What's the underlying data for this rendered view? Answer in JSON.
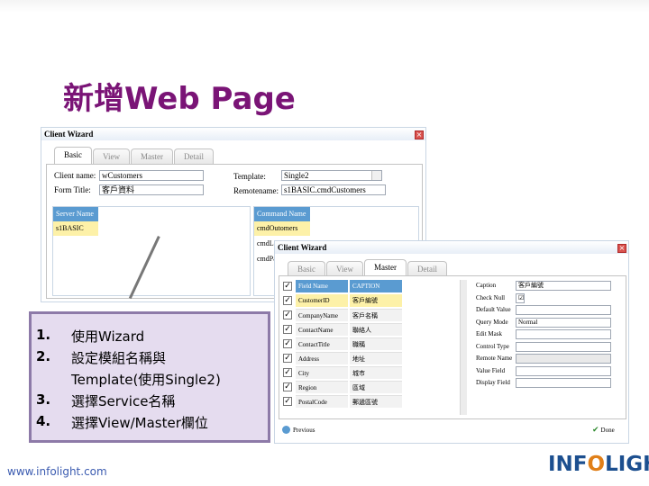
{
  "slide": {
    "title": "新增Web Page",
    "footer": "www.infolight.com",
    "logo": {
      "left": "INF",
      "middle": "O",
      "right": "LIGHT"
    }
  },
  "wizard1": {
    "title": "Client Wizard",
    "close_glyph": "×",
    "tabs": [
      "Basic",
      "View",
      "Master",
      "Detail"
    ],
    "fields": {
      "client_name_label": "Client name:",
      "client_name_value": "wCustomers",
      "form_title_label": "Form Title:",
      "form_title_value": "客戶資料",
      "template_label": "Template:",
      "template_value": "Single2",
      "remotename_label": "Remotename:",
      "remotename_value": "s1BASIC.cmdCustomers"
    },
    "server_grid": {
      "header": "Server Name",
      "rows": [
        "s1BASIC"
      ]
    },
    "command_grid": {
      "header": "Command Name",
      "rows": [
        "cmdOutomers",
        "cmdLo",
        "cmdPa"
      ]
    }
  },
  "wizard2": {
    "title": "Client Wizard",
    "close_glyph": "×",
    "tabs": [
      "Basic",
      "View",
      "Master",
      "Detail"
    ],
    "columns": [
      "Field Name",
      "CAPTION"
    ],
    "rows": [
      {
        "field": "CustomerID",
        "caption": "客戶編號",
        "checked": true
      },
      {
        "field": "CompanyName",
        "caption": "客戶名稱",
        "checked": true
      },
      {
        "field": "ContactName",
        "caption": "聯絡人",
        "checked": true
      },
      {
        "field": "ContactTitle",
        "caption": "職稱",
        "checked": true
      },
      {
        "field": "Address",
        "caption": "地址",
        "checked": true
      },
      {
        "field": "City",
        "caption": "城市",
        "checked": true
      },
      {
        "field": "Region",
        "caption": "區域",
        "checked": true
      },
      {
        "field": "PostalCode",
        "caption": "郵遞區號",
        "checked": true
      }
    ],
    "properties": [
      {
        "label": "Caption",
        "value": "客戶編號"
      },
      {
        "label": "Check Null",
        "value": "☑"
      },
      {
        "label": "Default Value",
        "value": ""
      },
      {
        "label": "Query Mode",
        "value": "Normal"
      },
      {
        "label": "Edit Mask",
        "value": ""
      },
      {
        "label": "Control Type",
        "value": ""
      },
      {
        "label": "Remote Name",
        "value": ""
      },
      {
        "label": "Value Field",
        "value": ""
      },
      {
        "label": "Display Field",
        "value": ""
      }
    ],
    "previous_label": "Previous",
    "done_label": "Done"
  },
  "callout": {
    "items": [
      {
        "num": "1.",
        "text": "使用Wizard"
      },
      {
        "num": "2.",
        "text": "設定模組名稱與"
      },
      {
        "num": "",
        "text": "Template(使用Single2)"
      },
      {
        "num": "3.",
        "text": "選擇Service名稱"
      },
      {
        "num": "4.",
        "text": "選擇View/Master欄位"
      }
    ]
  },
  "colors": {
    "title": "#7a1476",
    "grid_header": "#5a9bd1",
    "selection": "#fdf1a8",
    "callout_bg": "#e5dcef",
    "callout_border": "#8d7aa8",
    "logo_blue": "#1c4f8f",
    "logo_orange": "#e07f18"
  }
}
